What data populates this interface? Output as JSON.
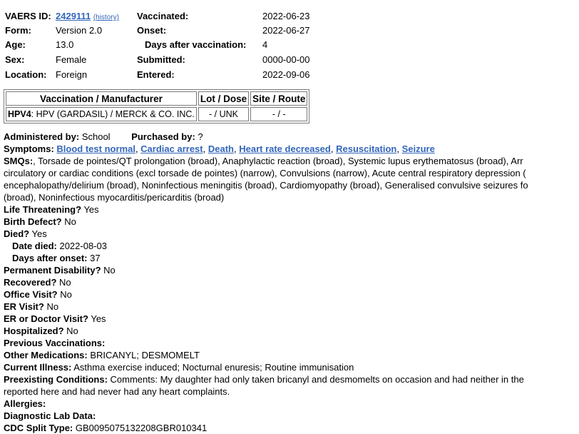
{
  "header": {
    "vaers_label": "VAERS ID:",
    "vaers_id": "2429111",
    "history_link": "(history)",
    "form_label": "Form:",
    "form_value": "Version 2.0",
    "age_label": "Age:",
    "age_value": "13.0",
    "sex_label": "Sex:",
    "sex_value": "Female",
    "location_label": "Location:",
    "location_value": "Foreign",
    "vaccinated_label": "Vaccinated:",
    "vaccinated_value": "2022-06-23",
    "onset_label": "Onset:",
    "onset_value": "2022-06-27",
    "days_after_label": "Days after vaccination:",
    "days_after_value": "4",
    "submitted_label": "Submitted:",
    "submitted_value": "0000-00-00",
    "entered_label": "Entered:",
    "entered_value": "2022-09-06"
  },
  "vax_table": {
    "headers": [
      "Vaccination / Manufacturer",
      "Lot / Dose",
      "Site / Route"
    ],
    "row": {
      "code": "HPV4",
      "name": ": HPV (GARDASIL) / MERCK & CO. INC.",
      "lot_dose": "- / UNK",
      "site_route": "- / -"
    }
  },
  "admin": {
    "administered_label": "Administered by:",
    "administered_value": "School",
    "purchased_label": "Purchased by:",
    "purchased_value": "?"
  },
  "symptoms": {
    "label": "Symptoms:",
    "items": [
      "Blood test normal",
      "Cardiac arrest",
      "Death",
      "Heart rate decreased",
      "Resuscitation",
      "Seizure"
    ]
  },
  "smqs": {
    "label": "SMQs:",
    "lines": [
      ", Torsade de pointes/QT prolongation (broad), Anaphylactic reaction (broad), Systemic lupus erythematosus (broad), Arr",
      "circulatory or cardiac conditions (excl torsade de pointes) (narrow), Convulsions (narrow), Acute central respiratory depression (",
      "encephalopathy/delirium (broad), Noninfectious meningitis (broad), Cardiomyopathy (broad), Generalised convulsive seizures fo",
      "(broad), Noninfectious myocarditis/pericarditis (broad)"
    ]
  },
  "fields": {
    "life_threatening_label": "Life Threatening?",
    "life_threatening_value": "Yes",
    "birth_defect_label": "Birth Defect?",
    "birth_defect_value": "No",
    "died_label": "Died?",
    "died_value": "Yes",
    "date_died_label": "Date died:",
    "date_died_value": "2022-08-03",
    "days_onset_label": "Days after onset:",
    "days_onset_value": "37",
    "disability_label": "Permanent Disability?",
    "disability_value": "No",
    "recovered_label": "Recovered?",
    "recovered_value": "No",
    "office_label": "Office Visit?",
    "office_value": "No",
    "er_label": "ER Visit?",
    "er_value": "No",
    "er_doctor_label": "ER or Doctor Visit?",
    "er_doctor_value": "Yes",
    "hospitalized_label": "Hospitalized?",
    "hospitalized_value": "No",
    "prev_vax_label": "Previous Vaccinations:",
    "other_meds_label": "Other Medications:",
    "other_meds_value": "BRICANYL; DESMOMELT",
    "current_illness_label": "Current Illness:",
    "current_illness_value": "Asthma exercise induced; Nocturnal enuresis; Routine immunisation",
    "preexisting_label": "Preexisting Conditions:",
    "preexisting_line1": "Comments: My daughter had only taken bricanyl and desmomelts on occasion and had neither in the",
    "preexisting_line2": "reported here and had never had any heart complaints.",
    "allergies_label": "Allergies:",
    "diag_label": "Diagnostic Lab Data:",
    "cdc_label": "CDC Split Type:",
    "cdc_value": "GB0095075132208GBR010341"
  },
  "colors": {
    "link": "#3366bb",
    "table_border": "#7a7a7a",
    "background": "#ffffff",
    "text": "#000000"
  }
}
